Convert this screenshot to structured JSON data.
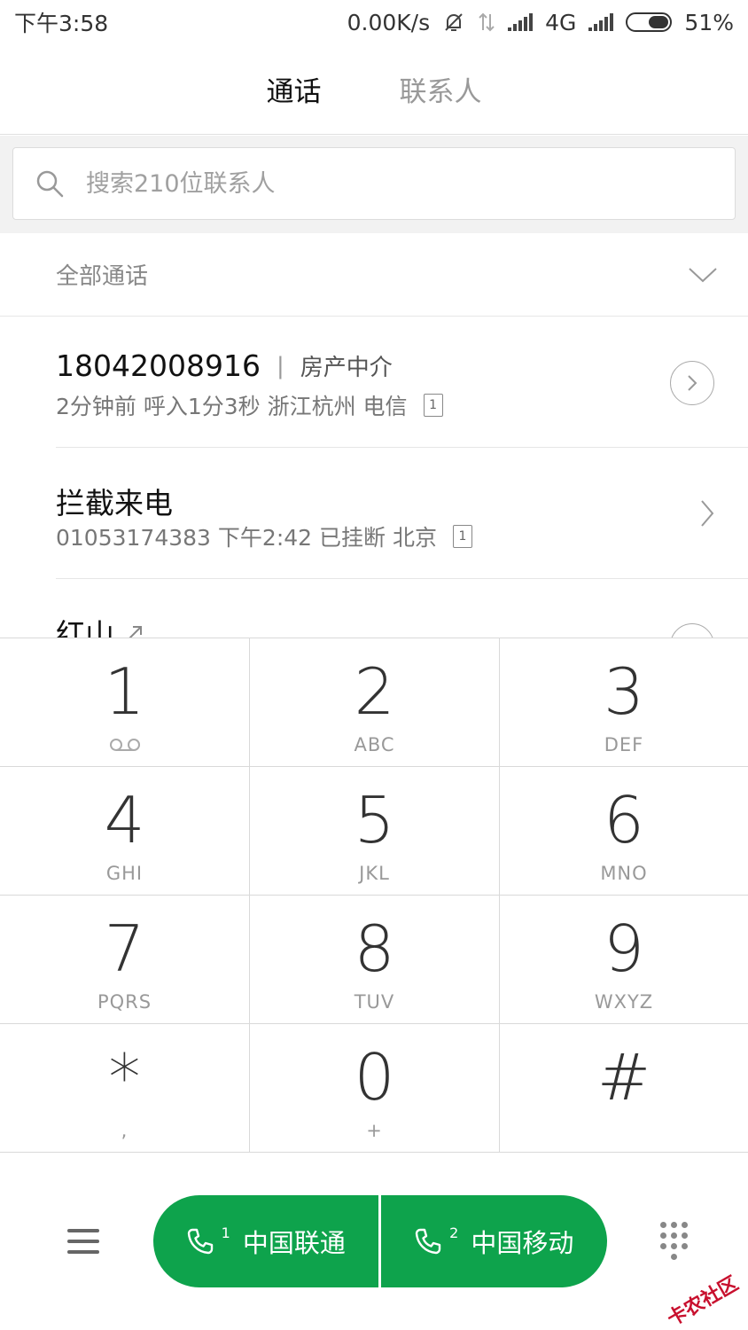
{
  "status_bar": {
    "time": "下午3:58",
    "speed": "0.00K/s",
    "network": "4G",
    "battery": "51%",
    "battery_level": 0.51
  },
  "tabs": [
    {
      "label": "通话",
      "active": true
    },
    {
      "label": "联系人",
      "active": false
    }
  ],
  "search": {
    "placeholder": "搜索210位联系人"
  },
  "filter": {
    "label": "全部通话"
  },
  "calls": [
    {
      "title": "18042008916",
      "tag": "房产中介",
      "sub": "2分钟前 呼入1分3秒  浙江杭州 电信",
      "sim": "1"
    },
    {
      "title": "拦截来电",
      "sub": "01053174383  下午2:42 已挂断  北京",
      "sim": "1"
    },
    {
      "title": "红山"
    }
  ],
  "dialpad": [
    {
      "digit": "1",
      "letters": ""
    },
    {
      "digit": "2",
      "letters": "ABC"
    },
    {
      "digit": "3",
      "letters": "DEF"
    },
    {
      "digit": "4",
      "letters": "GHI"
    },
    {
      "digit": "5",
      "letters": "JKL"
    },
    {
      "digit": "6",
      "letters": "MNO"
    },
    {
      "digit": "7",
      "letters": "PQRS"
    },
    {
      "digit": "8",
      "letters": "TUV"
    },
    {
      "digit": "9",
      "letters": "WXYZ"
    },
    {
      "digit": "*",
      "letters": ","
    },
    {
      "digit": "0",
      "letters": "+"
    },
    {
      "digit": "#",
      "letters": ""
    }
  ],
  "call_buttons": [
    {
      "sim": "1",
      "label": "中国联通"
    },
    {
      "sim": "2",
      "label": "中国移动"
    }
  ],
  "watermark": "卡农社区",
  "colors": {
    "accent_green": "#0ea34c"
  }
}
